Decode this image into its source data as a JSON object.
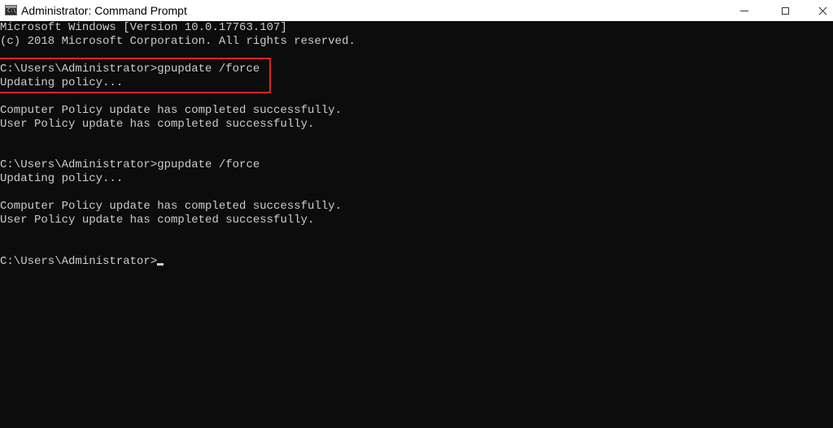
{
  "window": {
    "title": "Administrator: Command Prompt",
    "icon": "cmd-icon",
    "controls": [
      "minimize-icon",
      "maximize-icon",
      "close-icon"
    ]
  },
  "console": {
    "lines": [
      "Microsoft Windows [Version 10.0.17763.107]",
      "(c) 2018 Microsoft Corporation. All rights reserved.",
      "",
      "C:\\Users\\Administrator>gpupdate /force",
      "Updating policy...",
      "",
      "Computer Policy update has completed successfully.",
      "User Policy update has completed successfully.",
      "",
      "",
      "C:\\Users\\Administrator>gpupdate /force",
      "Updating policy...",
      "",
      "Computer Policy update has completed successfully.",
      "User Policy update has completed successfully.",
      "",
      "",
      "C:\\Users\\Administrator>"
    ]
  },
  "colors": {
    "console_background": "#0c0c0c",
    "console_text": "#cccccc",
    "highlight_border": "#e0222a"
  }
}
